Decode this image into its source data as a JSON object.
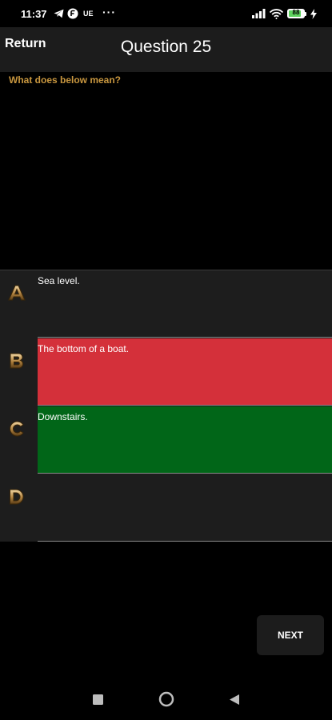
{
  "status_bar": {
    "time": "11:37",
    "carrier_tag": "UE",
    "more": "···",
    "battery_level": "88"
  },
  "toolbar": {
    "return_label": "Return",
    "title": "Question 25"
  },
  "question": {
    "prompt": "What does below mean?"
  },
  "answers": [
    {
      "letter": "A",
      "text": "Sea level.",
      "state": "default"
    },
    {
      "letter": "B",
      "text": "The bottom of a boat.",
      "state": "incorrect"
    },
    {
      "letter": "C",
      "text": "Downstairs.",
      "state": "correct"
    },
    {
      "letter": "D",
      "text": "",
      "state": "default"
    }
  ],
  "colors": {
    "incorrect": "#d4303a",
    "correct": "#016618",
    "prompt": "#c9973f",
    "panel": "#1d1d1d"
  },
  "next_button": {
    "label": "NEXT"
  },
  "icons": {
    "telegram": "telegram-icon",
    "app": "app-badge-icon",
    "signal": "signal-icon",
    "wifi": "wifi-icon",
    "battery": "battery-icon",
    "charging": "charging-icon",
    "nav_recent": "recent-apps-icon",
    "nav_home": "home-icon",
    "nav_back": "back-icon"
  }
}
